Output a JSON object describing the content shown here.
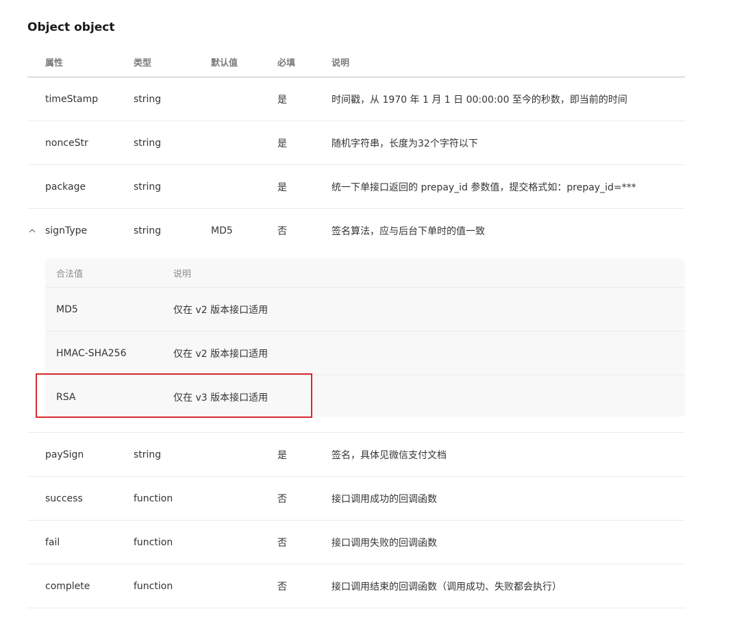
{
  "section_title": "Object object",
  "headers": [
    "属性",
    "类型",
    "默认值",
    "必填",
    "说明"
  ],
  "rows_before": [
    {
      "name": "timeStamp",
      "type": "string",
      "default": "",
      "required": "是",
      "desc": "时间戳，从 1970 年 1 月 1 日 00:00:00 至今的秒数，即当前的时间"
    },
    {
      "name": "nonceStr",
      "type": "string",
      "default": "",
      "required": "是",
      "desc": "随机字符串，长度为32个字符以下"
    },
    {
      "name": "package",
      "type": "string",
      "default": "",
      "required": "是",
      "desc": "统一下单接口返回的 prepay_id 参数值，提交格式如：prepay_id=***"
    }
  ],
  "expanded_row": {
    "name": "signType",
    "type": "string",
    "default": "MD5",
    "required": "否",
    "desc": "签名算法，应与后台下单时的值一致",
    "sub_headers": [
      "合法值",
      "说明"
    ],
    "sub_rows": [
      {
        "value": "MD5",
        "desc": "仅在 v2 版本接口适用"
      },
      {
        "value": "HMAC-SHA256",
        "desc": "仅在 v2 版本接口适用"
      },
      {
        "value": "RSA",
        "desc": "仅在 v3 版本接口适用"
      }
    ]
  },
  "rows_after": [
    {
      "name": "paySign",
      "type": "string",
      "default": "",
      "required": "是",
      "desc": "签名，具体见微信支付文档"
    },
    {
      "name": "success",
      "type": "function",
      "default": "",
      "required": "否",
      "desc": "接口调用成功的回调函数"
    },
    {
      "name": "fail",
      "type": "function",
      "default": "",
      "required": "否",
      "desc": "接口调用失败的回调函数"
    },
    {
      "name": "complete",
      "type": "function",
      "default": "",
      "required": "否",
      "desc": "接口调用结束的回调函数（调用成功、失败都会执行）"
    }
  ],
  "highlight_color": "#d9272f",
  "icons": {
    "collapse": "chevron-up-icon"
  }
}
